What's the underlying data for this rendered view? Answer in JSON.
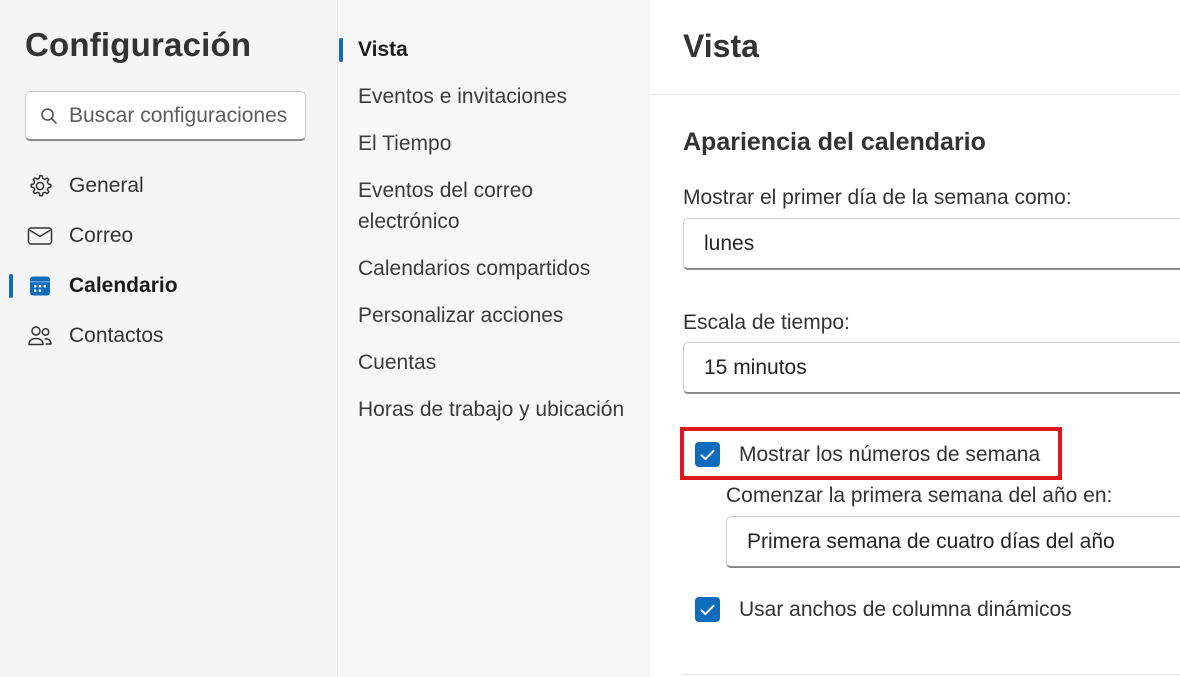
{
  "sidebar": {
    "title": "Configuración",
    "search": {
      "placeholder": "Buscar configuraciones"
    },
    "categories": [
      {
        "label": "General",
        "icon": "gear-icon"
      },
      {
        "label": "Correo",
        "icon": "mail-icon"
      },
      {
        "label": "Calendario",
        "icon": "calendar-icon",
        "selected": true
      },
      {
        "label": "Contactos",
        "icon": "people-icon"
      }
    ]
  },
  "submenu": {
    "items": [
      {
        "label": "Vista",
        "selected": true
      },
      {
        "label": "Eventos e invitaciones"
      },
      {
        "label": "El Tiempo"
      },
      {
        "label": "Eventos del correo electrónico"
      },
      {
        "label": "Calendarios compartidos"
      },
      {
        "label": "Personalizar acciones"
      },
      {
        "label": "Cuentas"
      },
      {
        "label": "Horas de trabajo y ubicación"
      }
    ]
  },
  "main": {
    "title": "Vista",
    "section_title": "Apariencia del calendario",
    "first_day": {
      "label": "Mostrar el primer día de la semana como:",
      "value": "lunes"
    },
    "time_scale": {
      "label": "Escala de tiempo:",
      "value": "15 minutos"
    },
    "show_week_numbers": {
      "label": "Mostrar los números de semana",
      "checked": true
    },
    "first_week": {
      "label": "Comenzar la primera semana del año en:",
      "value": "Primera semana de cuatro días del año"
    },
    "dynamic_columns": {
      "label": "Usar anchos de columna dinámicos",
      "checked": true
    }
  },
  "colors": {
    "accent": "#0f6cbd",
    "highlight": "#e0161b",
    "sidebar_bg": "#f5f5f5"
  }
}
